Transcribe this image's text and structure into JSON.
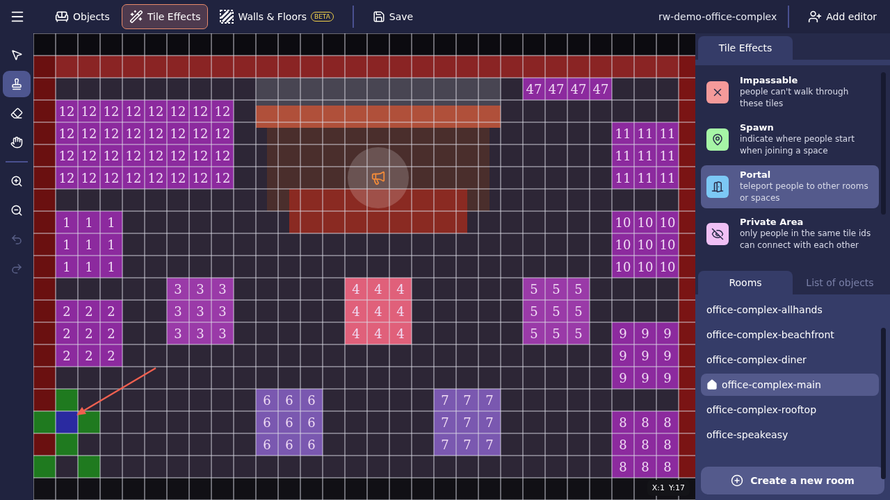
{
  "topbar": {
    "tabs": [
      {
        "label": "Objects",
        "selected": false
      },
      {
        "label": "Tile Effects",
        "selected": true
      },
      {
        "label": "Walls & Floors",
        "selected": false,
        "badge": "BETA"
      }
    ],
    "save": "Save",
    "space_name": "rw-demo-office-complex",
    "add_editor": "Add editor"
  },
  "tools": [
    {
      "selected": false,
      "disabled": false
    },
    {
      "selected": true,
      "disabled": false
    },
    {
      "selected": false,
      "disabled": false
    },
    {
      "selected": false,
      "disabled": false
    },
    {
      "selected": false,
      "disabled": false
    },
    {
      "selected": false,
      "disabled": false
    },
    {
      "selected": false,
      "disabled": true
    },
    {
      "selected": false,
      "disabled": true
    }
  ],
  "map": {
    "zones": [
      {
        "color": "#8c2a9e",
        "cells": [
          [
            "12",
            "12",
            "12",
            "12",
            "12",
            "12",
            "12",
            "12"
          ],
          [
            "12",
            "12",
            "12",
            "12",
            "12",
            "12",
            "12",
            "12"
          ],
          [
            "12",
            "12",
            "12",
            "12",
            "12",
            "12",
            "12",
            "12"
          ],
          [
            "12",
            "12",
            "12",
            "12",
            "12",
            "12",
            "12",
            "12"
          ]
        ]
      },
      {
        "color": "#8c2a9e",
        "cells": [
          [
            "47",
            "47",
            "47",
            "47"
          ]
        ]
      },
      {
        "color": "#8c2a9e",
        "cells": [
          [
            "11",
            "11",
            "11"
          ],
          [
            "11",
            "11",
            "11"
          ],
          [
            "11",
            "11",
            "11"
          ]
        ]
      },
      {
        "color": "#8c2a9e",
        "cells": [
          [
            "1",
            "1",
            "1"
          ],
          [
            "1",
            "1",
            "1"
          ],
          [
            "1",
            "1",
            "1"
          ]
        ]
      },
      {
        "color": "#8c2a9e",
        "cells": [
          [
            "10",
            "10",
            "10"
          ],
          [
            "10",
            "10",
            "10"
          ],
          [
            "10",
            "10",
            "10"
          ]
        ]
      },
      {
        "color": "#9a3aa8",
        "cells": [
          [
            "3",
            "3",
            "3"
          ],
          [
            "3",
            "3",
            "3"
          ],
          [
            "3",
            "3",
            "3"
          ]
        ]
      },
      {
        "color": "#e0607a",
        "cells": [
          [
            "4",
            "4",
            "4"
          ],
          [
            "4",
            "4",
            "4"
          ],
          [
            "4",
            "4",
            "4"
          ]
        ]
      },
      {
        "color": "#9a3aa8",
        "cells": [
          [
            "5",
            "5",
            "5"
          ],
          [
            "5",
            "5",
            "5"
          ],
          [
            "5",
            "5",
            "5"
          ]
        ]
      },
      {
        "color": "#8c2a9e",
        "cells": [
          [
            "2",
            "2",
            "2"
          ],
          [
            "2",
            "2",
            "2"
          ],
          [
            "2",
            "2",
            "2"
          ]
        ]
      },
      {
        "color": "#8c2a9e",
        "cells": [
          [
            "9",
            "9",
            "9"
          ],
          [
            "9",
            "9",
            "9"
          ],
          [
            "9",
            "9",
            "9"
          ]
        ]
      },
      {
        "color": "#7a58b0",
        "cells": [
          [
            "6",
            "6",
            "6"
          ],
          [
            "6",
            "6",
            "6"
          ],
          [
            "6",
            "6",
            "6"
          ]
        ]
      },
      {
        "color": "#7a58b0",
        "cells": [
          [
            "7",
            "7",
            "7"
          ],
          [
            "7",
            "7",
            "7"
          ],
          [
            "7",
            "7",
            "7"
          ]
        ]
      },
      {
        "color": "#8c2a9e",
        "cells": [
          [
            "8",
            "8",
            "8"
          ],
          [
            "8",
            "8",
            "8"
          ],
          [
            "8",
            "8",
            "8"
          ]
        ]
      }
    ],
    "effects": [
      {
        "kind": "spawn"
      },
      {
        "kind": "spawn"
      },
      {
        "kind": "portal"
      },
      {
        "kind": "spawn"
      },
      {
        "kind": "spawn"
      },
      {
        "kind": "spawn"
      },
      {
        "kind": "spawn"
      }
    ],
    "coords": {
      "x": "X:1",
      "y": "Y:17"
    }
  },
  "side": {
    "effects_tab": {
      "label": "Tile Effects",
      "selected": true
    },
    "effects": [
      {
        "title": "Impassable",
        "description": "people can't walk through these tiles",
        "color": "#f59a9a",
        "selected": false
      },
      {
        "title": "Spawn",
        "description": "indicate where people start when joining a space",
        "color": "#a6f5a6",
        "selected": false
      },
      {
        "title": "Portal",
        "description": "teleport people to other rooms or spaces",
        "color": "#7cc8f5",
        "selected": true
      },
      {
        "title": "Private Area",
        "description": "only people in the same tile ids can connect with each other",
        "color": "#f0c0f5",
        "selected": false
      }
    ],
    "room_tabs": [
      {
        "label": "Rooms",
        "selected": true
      },
      {
        "label": "List of objects",
        "selected": false
      }
    ],
    "rooms": [
      {
        "name": "office-complex-allhands",
        "selected": false,
        "home": false
      },
      {
        "name": "office-complex-beachfront",
        "selected": false,
        "home": false
      },
      {
        "name": "office-complex-diner",
        "selected": false,
        "home": false
      },
      {
        "name": "office-complex-main",
        "selected": true,
        "home": true
      },
      {
        "name": "office-complex-rooftop",
        "selected": false,
        "home": false
      },
      {
        "name": "office-speakeasy",
        "selected": false,
        "home": false
      }
    ],
    "create_room": "Create a new room"
  }
}
